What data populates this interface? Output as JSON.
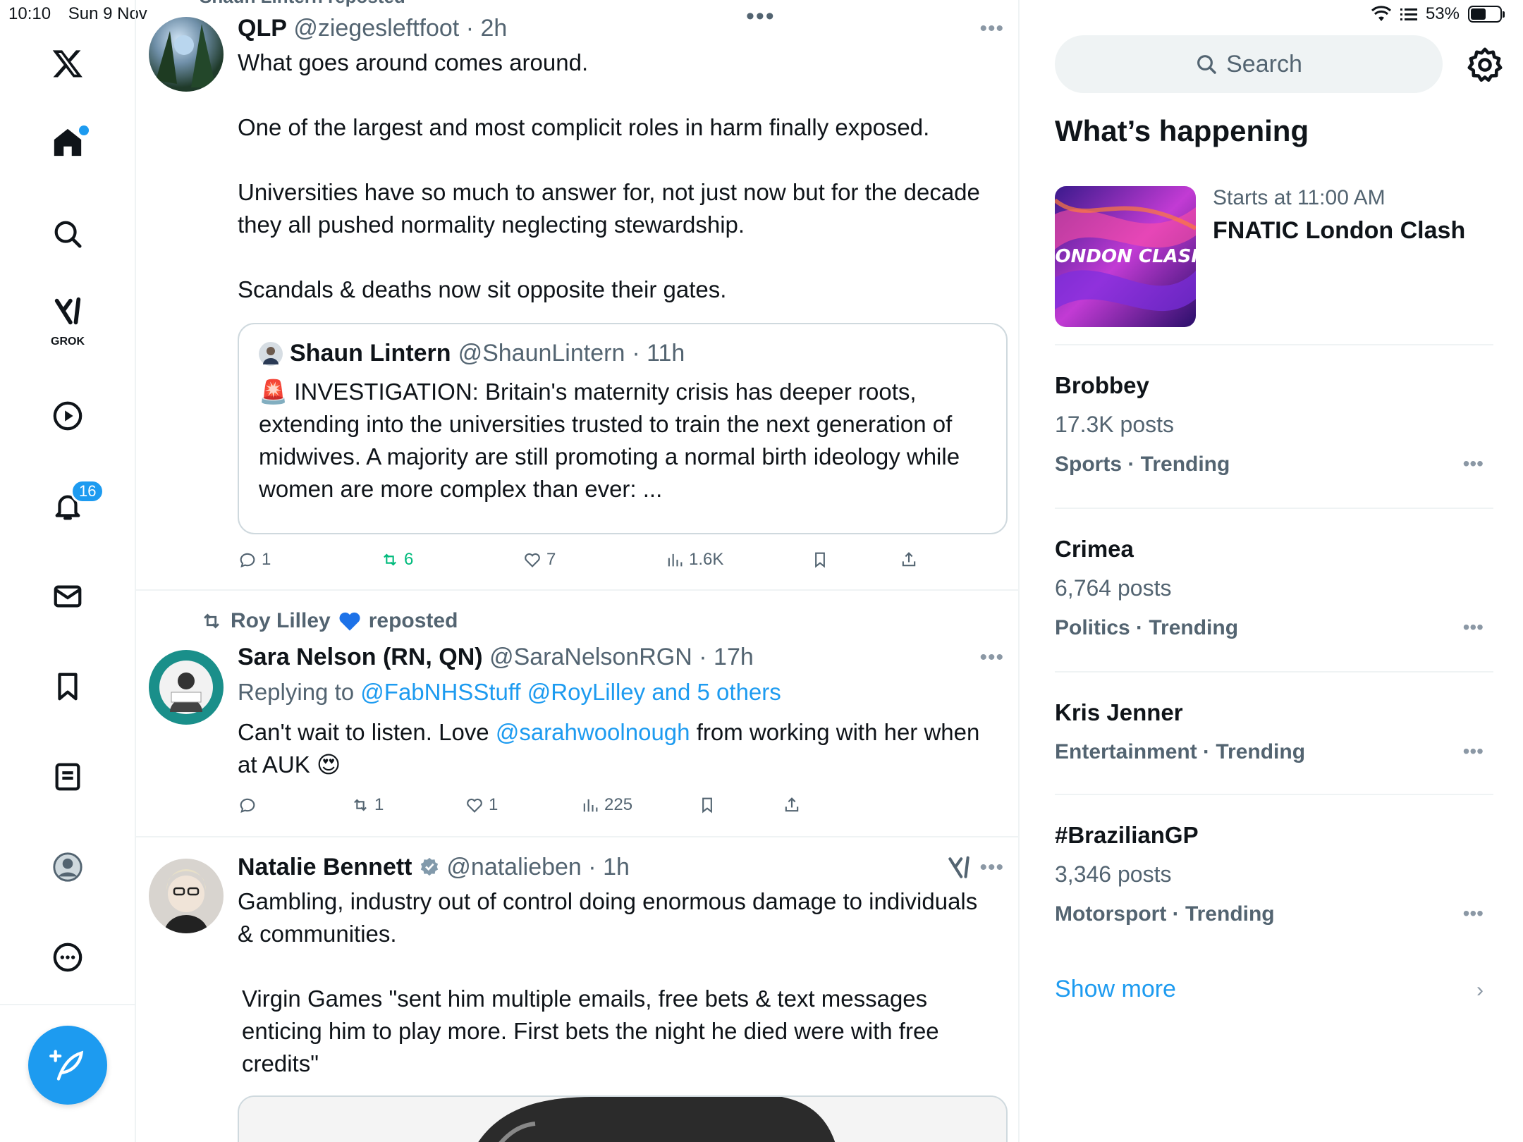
{
  "status": {
    "time": "10:10",
    "date": "Sun 9 Nov",
    "battery": "53%",
    "battery_level": 0.53
  },
  "nav": {
    "logo": "x-logo-icon",
    "items": [
      {
        "name": "home",
        "icon": "home-icon"
      },
      {
        "name": "explore",
        "icon": "search-icon"
      },
      {
        "name": "grok",
        "icon": "grok-icon",
        "label": "GROK"
      },
      {
        "name": "video",
        "icon": "play-icon"
      },
      {
        "name": "notifications",
        "icon": "bell-icon",
        "badge": "16"
      },
      {
        "name": "messages",
        "icon": "mail-icon"
      },
      {
        "name": "bookmarks",
        "icon": "bookmark-icon"
      },
      {
        "name": "lists",
        "icon": "list-icon"
      },
      {
        "name": "profile",
        "icon": "avatar-icon"
      },
      {
        "name": "more",
        "icon": "more-circle-icon"
      }
    ],
    "compose_icon": "compose-icon"
  },
  "timeline": {
    "posts": [
      {
        "repost_by": "Shaun Lintern reposted",
        "name": "QLP",
        "handle": "@ziegesleftfoot",
        "time": "· 2h",
        "paragraphs": [
          "What goes around comes around.",
          "One of the largest and most complicit roles in harm finally exposed.",
          "Universities have so much to answer for, not just now but for the decade they all pushed normality neglecting stewardship.",
          "Scandals & deaths now sit opposite their gates."
        ],
        "quote": {
          "name": "Shaun Lintern",
          "handle": "@ShaunLintern",
          "time": "· 11h",
          "text": "🚨 INVESTIGATION: Britain's maternity crisis has deeper roots, extending into the universities trusted to train the next generation of midwives. A majority are still promoting a normal birth ideology while women are more complex than ever: ..."
        },
        "stats": {
          "replies": "1",
          "reposts": "6",
          "likes": "7",
          "views": "1.6K"
        }
      },
      {
        "repost_by": "Roy Lilley",
        "repost_suffix": "reposted",
        "name": "Sara Nelson (RN, QN)",
        "handle": "@SaraNelsonRGN",
        "time": "· 17h",
        "replying_prefix": "Replying to",
        "replying_to": "@FabNHSStuff @RoyLilley and 5 others",
        "text_pre": "Can't wait to listen. Love",
        "mention": "@sarahwoolnough",
        "text_post": "from working with her when at AUK 😍",
        "stats": {
          "replies": "",
          "reposts": "1",
          "likes": "1",
          "views": "225"
        }
      },
      {
        "name": "Natalie Bennett",
        "handle": "@natalieben",
        "time": "· 1h",
        "paragraphs": [
          "Gambling, industry out of control doing enormous damage to individuals & communities.",
          "Virgin Games \"sent him multiple emails, free bets & text messages enticing him to play more. First bets the night he died were with free credits\""
        ]
      }
    ]
  },
  "sidebar": {
    "search_placeholder": "Search",
    "title": "What’s happening",
    "event": {
      "subtitle": "Starts at 11:00 AM",
      "title": "FNATIC London Clash",
      "image_text": "LONDON CLASH"
    },
    "trends": [
      {
        "name": "Brobbey",
        "posts": "17.3K posts",
        "category": "Sports · Trending"
      },
      {
        "name": "Crimea",
        "posts": "6,764 posts",
        "category": "Politics · Trending"
      },
      {
        "name": "Kris Jenner",
        "posts": "",
        "category": "Entertainment · Trending"
      },
      {
        "name": "#BrazilianGP",
        "posts": "3,346 posts",
        "category": "Motorsport · Trending"
      }
    ],
    "show_more": "Show more"
  },
  "colors": {
    "accent": "#1d9bf0",
    "repost_green": "#00ba7c",
    "muted": "#536471"
  }
}
